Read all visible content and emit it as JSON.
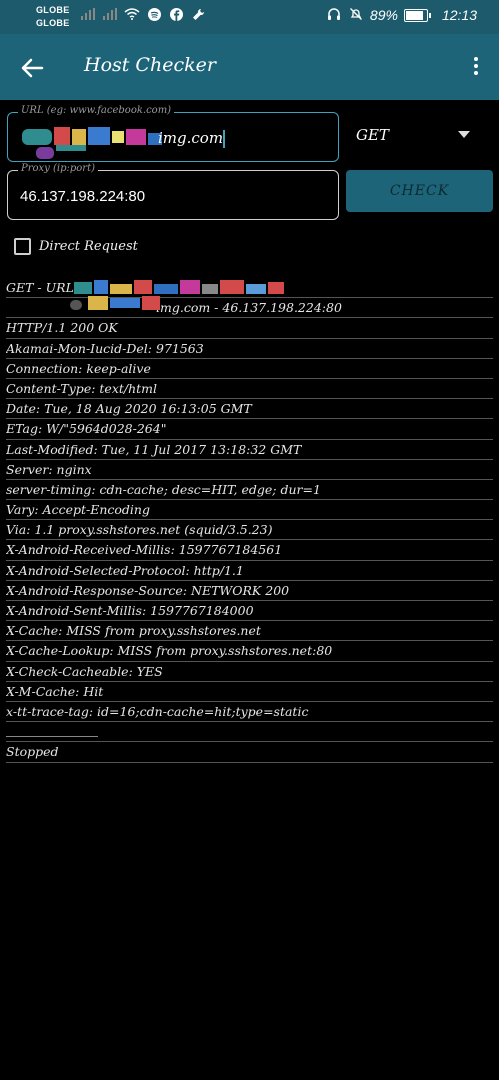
{
  "status_bar": {
    "carrier_1": "GLOBE",
    "carrier_2": "GLOBE",
    "battery": "89%",
    "time": "12:13",
    "icons_left": [
      "signal-icon",
      "signal-icon",
      "wifi-icon",
      "spotify-icon",
      "facebook-icon",
      "wrench-icon"
    ],
    "icons_right": [
      "headphones-icon",
      "mute-icon",
      "battery-icon"
    ]
  },
  "app_bar": {
    "title": "Host Checker"
  },
  "url_input": {
    "label": "URL (eg: www.facebook.com)",
    "value_visible": "img.com"
  },
  "proxy_input": {
    "label": "Proxy (ip:port)",
    "value": "46.137.198.224:80"
  },
  "method": {
    "selected": "GET"
  },
  "check_button": {
    "label": "CHECK"
  },
  "direct_request": {
    "label": "Direct Request",
    "checked": false
  },
  "log": {
    "lines": [
      "GET - URL:",
      "img.com - 46.137.198.224:80",
      "HTTP/1.1 200 OK",
      "Akamai-Mon-Iucid-Del: 971563",
      "Connection: keep-alive",
      "Content-Type: text/html",
      "Date: Tue, 18 Aug 2020 16:13:05 GMT",
      "ETag: W/\"5964d028-264\"",
      "Last-Modified: Tue, 11 Jul 2017 13:18:32 GMT",
      "Server: nginx",
      "server-timing: cdn-cache; desc=HIT, edge; dur=1",
      "Vary: Accept-Encoding",
      "Via: 1.1 proxy.sshstores.net (squid/3.5.23)",
      "X-Android-Received-Millis: 1597767184561",
      "X-Android-Selected-Protocol: http/1.1",
      "X-Android-Response-Source: NETWORK 200",
      "X-Android-Sent-Millis: 1597767184000",
      "X-Cache: MISS from proxy.sshstores.net",
      "X-Cache-Lookup: MISS from proxy.sshstores.net:80",
      "X-Check-Cacheable: YES",
      "X-M-Cache: Hit",
      "x-tt-trace-tag: id=16;cdn-cache=hit;type=static",
      "",
      "Stopped"
    ]
  },
  "colors": {
    "app_bar": "#1d6478",
    "status_bar": "#1c5a6c",
    "accent": "#3fa3bf",
    "background": "#000000"
  }
}
